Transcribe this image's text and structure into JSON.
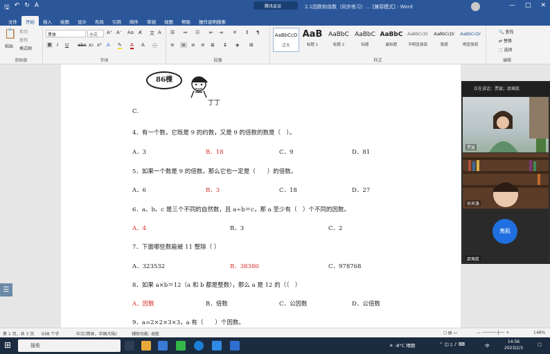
{
  "window": {
    "doc_title": "2.1因数和倍数（同步练习）…  [兼容模式] - Word",
    "meeting_label": "腾讯会议",
    "controls": [
      "—",
      "□",
      "✕"
    ]
  },
  "tabs": [
    "文件",
    "开始",
    "插入",
    "绘图",
    "设计",
    "布局",
    "引用",
    "邮件",
    "审阅",
    "视图",
    "帮助",
    "操作说明搜索"
  ],
  "ribbon": {
    "clipboard": {
      "paste": "粘贴",
      "cut": "剪切",
      "copy": "复制",
      "format_painter": "格式刷",
      "label": "剪贴板"
    },
    "font": {
      "name": "黑体",
      "size": "小三",
      "label": "字体"
    },
    "paragraph": {
      "label": "段落"
    },
    "styles": {
      "label": "样式",
      "items": [
        {
          "sample": "AaBbCcD",
          "name": "正文"
        },
        {
          "sample": "AaB",
          "name": "标题 1"
        },
        {
          "sample": "AaBbC",
          "name": "标题 2"
        },
        {
          "sample": "AaBbC",
          "name": "标题"
        },
        {
          "sample": "AaBbC",
          "name": "副标题"
        },
        {
          "sample": "AaBbCcDi",
          "name": "不明显强调"
        },
        {
          "sample": "AaBbCcDi",
          "name": "强调"
        },
        {
          "sample": "AaBbCcDi",
          "name": "明显强调"
        }
      ]
    },
    "editing": {
      "find": "查找",
      "replace": "替换",
      "select": "选择",
      "label": "编辑"
    }
  },
  "document": {
    "stamp": "86棵",
    "stamp_caption": "丁丁",
    "prev_option": "C.",
    "questions": [
      {
        "text": "4．有一个数，它既是 9 的约数，又是 9 的倍数的数是（　）。",
        "options": [
          "A．3",
          "B．18",
          "C．9",
          "D．81"
        ],
        "answer": 1
      },
      {
        "text": "5．如果一个数是 9 的倍数，那么它也一定是（　　）的倍数。",
        "options": [
          "A．6",
          "B．3",
          "C．18",
          "D．27"
        ],
        "answer": 1
      },
      {
        "text": "6．a、b、c 是三个不同的自然数，且 a÷b＝c，那 a 至少有（　）个不同的因数。",
        "options": [
          "A．4",
          "B．3",
          "C．2"
        ],
        "answer": 0
      },
      {
        "text": "7．下面哪些数能被 11 整除（ ）",
        "options": [
          "A．323532",
          "B．38380",
          "C．978768"
        ],
        "answer": 1
      },
      {
        "text": "8．如果 a×b＝12（a 和 b 都是整数），那么 a 是 12 的（（　）",
        "options": [
          "A．因数",
          "B．倍数",
          "C．公因数",
          "D．公倍数"
        ],
        "answer": 0
      },
      {
        "text": "9．a=2×2×3×3，a 有（　　）个因数。",
        "options": [],
        "answer": -1
      }
    ]
  },
  "video_panel": {
    "speaking": "正在讲话：贾宸；邵夷航",
    "tiles": [
      {
        "name": "贾宸"
      },
      {
        "name": "孙天洛"
      },
      {
        "name": "邵夷航"
      }
    ],
    "host_button": "夷航"
  },
  "statusbar": {
    "page": "第 1 页，共 3 页",
    "words": "938 个字",
    "lang": "中文(简体，中国大陆)",
    "access": "辅助功能: 调查",
    "zoom": "148%"
  },
  "taskbar": {
    "search": "搜索",
    "weather": "-8°C 晴朗",
    "ime": "中",
    "time": "14:56",
    "date": "2023/2/3"
  },
  "colors": {
    "word_blue": "#2b579a",
    "answer_red": "#d92626",
    "host_blue": "#1f6fe0"
  }
}
